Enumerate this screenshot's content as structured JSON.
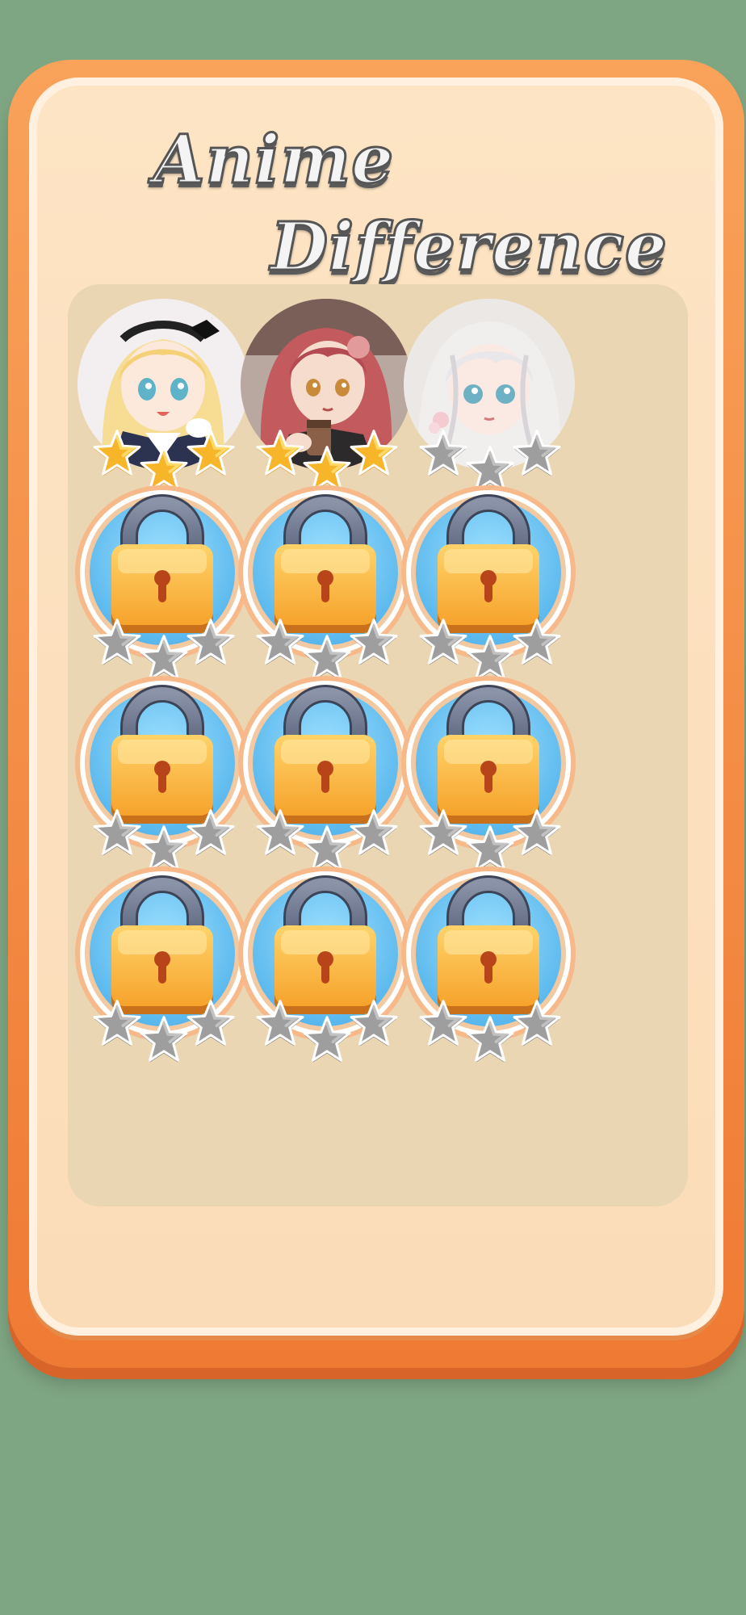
{
  "title": {
    "line1": "Anime",
    "line2": "Difference"
  },
  "colors": {
    "background": "#7fa683",
    "frame_orange": "#ef7a34",
    "panel_cream": "#fde4c4",
    "grid_tan": "#ead6b2",
    "star_gold": "#f7b62a",
    "star_gray": "#9e9e9e",
    "badge_blue": "#57b6ec",
    "lock_orange": "#f6a32c"
  },
  "levels": [
    {
      "id": "level-1",
      "state": "unlocked",
      "image": "blonde-girl-sailor-outfit",
      "stars_earned": 3
    },
    {
      "id": "level-2",
      "state": "unlocked",
      "image": "pink-hair-girl-with-cup",
      "stars_earned": 3
    },
    {
      "id": "level-3",
      "state": "unlocked",
      "image": "white-hair-girl",
      "stars_earned": 0
    },
    {
      "id": "level-4",
      "state": "locked",
      "icon": "lock-icon",
      "stars_earned": 0
    },
    {
      "id": "level-5",
      "state": "locked",
      "icon": "lock-icon",
      "stars_earned": 0
    },
    {
      "id": "level-6",
      "state": "locked",
      "icon": "lock-icon",
      "stars_earned": 0
    },
    {
      "id": "level-7",
      "state": "locked",
      "icon": "lock-icon",
      "stars_earned": 0
    },
    {
      "id": "level-8",
      "state": "locked",
      "icon": "lock-icon",
      "stars_earned": 0
    },
    {
      "id": "level-9",
      "state": "locked",
      "icon": "lock-icon",
      "stars_earned": 0
    },
    {
      "id": "level-10",
      "state": "locked",
      "icon": "lock-icon",
      "stars_earned": 0
    },
    {
      "id": "level-11",
      "state": "locked",
      "icon": "lock-icon",
      "stars_earned": 0
    },
    {
      "id": "level-12",
      "state": "locked",
      "icon": "lock-icon",
      "stars_earned": 0
    }
  ],
  "stars_per_level": 3
}
